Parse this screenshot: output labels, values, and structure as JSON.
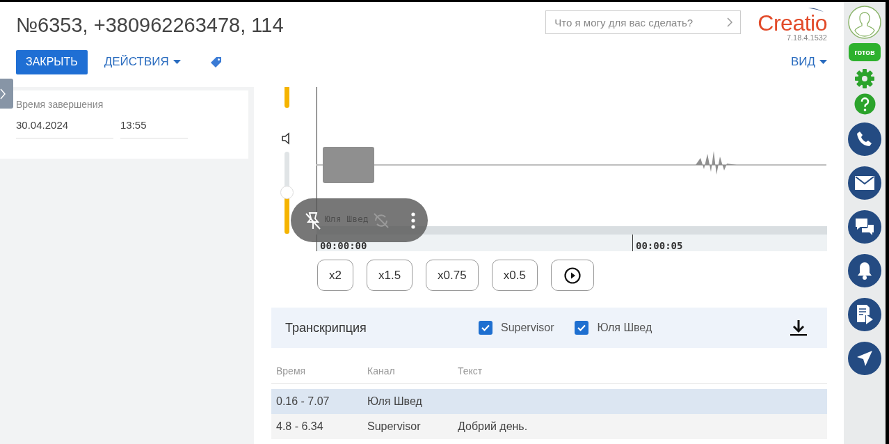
{
  "header": {
    "title": "№6353, +380962263478, 114",
    "close_button": "ЗАКРЫТЬ",
    "actions_menu": "ДЕЙСТВИЯ",
    "search": {
      "placeholder": "Что я могу для вас сделать?"
    },
    "logo": "Creatio",
    "version": "7.18.4.1532",
    "view_menu": "ВИД"
  },
  "details": {
    "label": "Время завершения",
    "date": "30.04.2024",
    "time": "13:55"
  },
  "player": {
    "volume": {
      "level": 0.5
    },
    "track_label": "Юля Швед",
    "time_marks": [
      "00:00:00",
      "00:00:05"
    ],
    "speeds": [
      "x2",
      "x1.5",
      "x0.75",
      "x0.5"
    ]
  },
  "transcription": {
    "title": "Транскрипция",
    "channels": [
      {
        "label": "Supervisor",
        "checked": true
      },
      {
        "label": "Юля Швед",
        "checked": true
      }
    ],
    "columns": [
      "Время",
      "Канал",
      "Текст"
    ],
    "rows": [
      {
        "time": "0.16 - 7.07",
        "channel": "Юля Швед",
        "selected": true
      },
      {
        "time": "4.8 - 6.34",
        "channel": "Supervisor",
        "text": "Добрий день.",
        "selected": false
      }
    ]
  },
  "sidebar": {
    "status": "готов"
  }
}
